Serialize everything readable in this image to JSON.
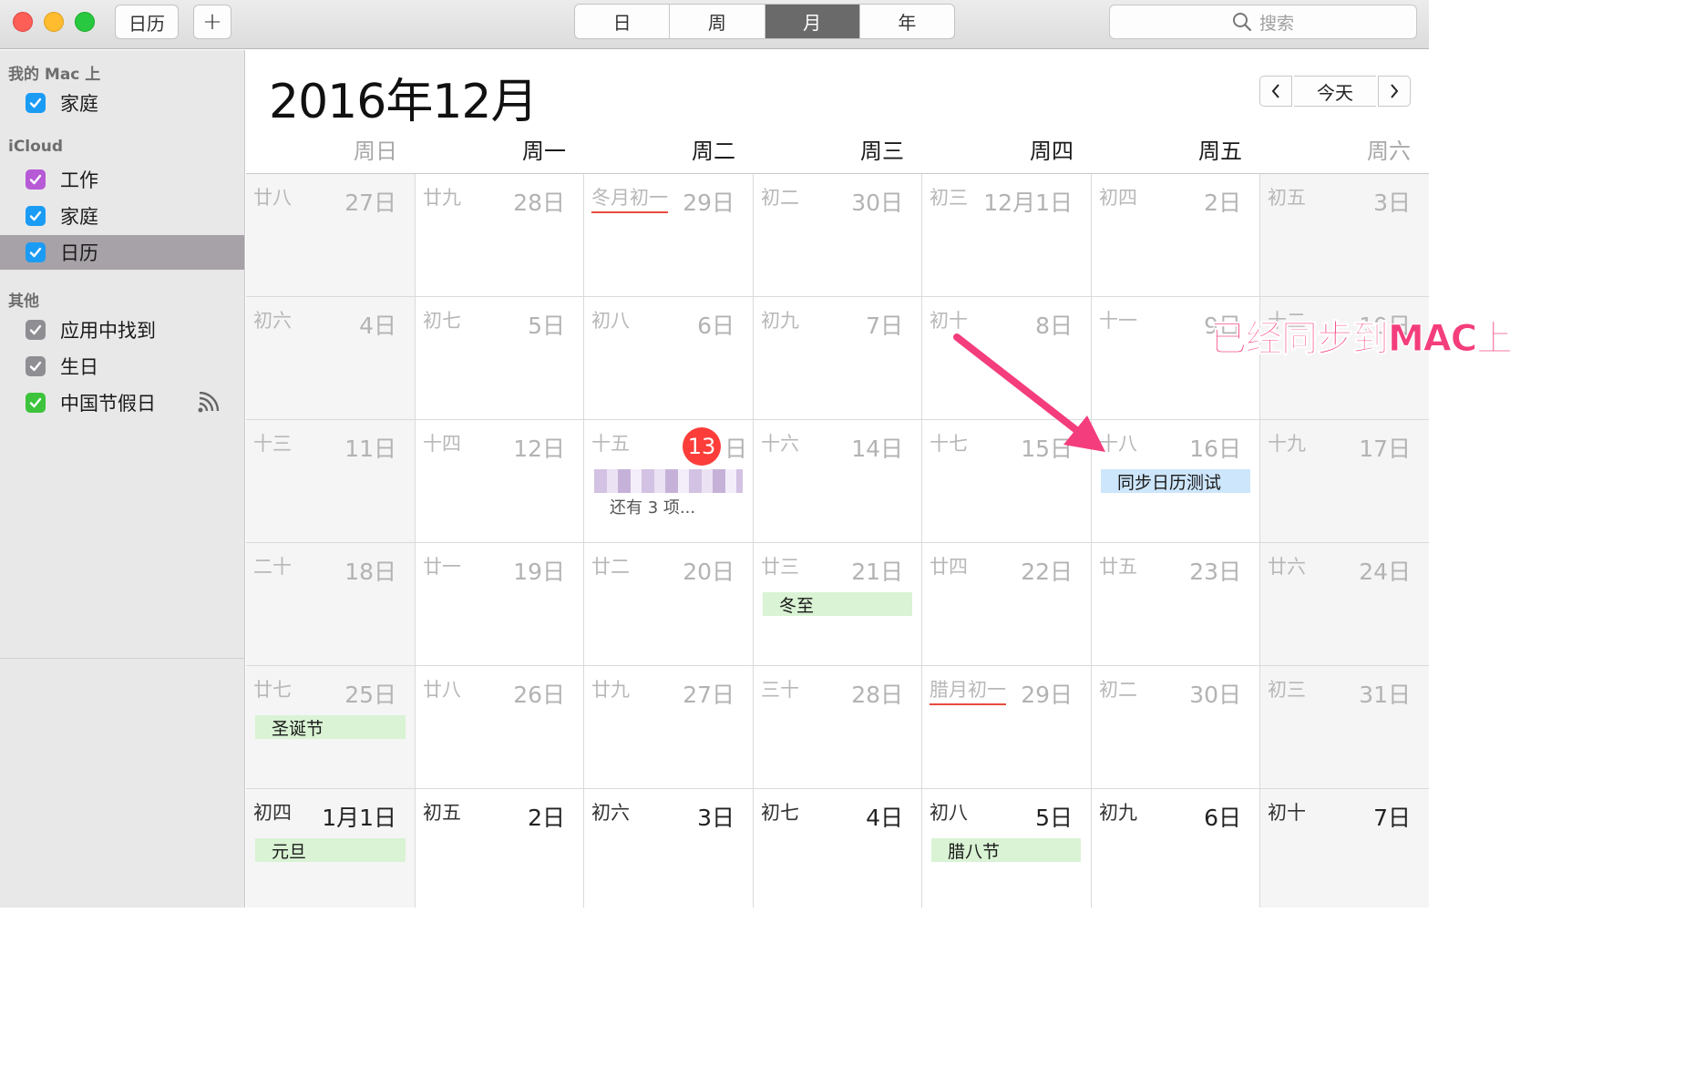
{
  "window": {
    "toolbar": {
      "calendars_button": "日历",
      "add_button": "+",
      "views": [
        {
          "label": "日",
          "active": false
        },
        {
          "label": "周",
          "active": false
        },
        {
          "label": "月",
          "active": true
        },
        {
          "label": "年",
          "active": false
        }
      ],
      "search_placeholder": "搜索"
    },
    "sidebar": {
      "groups": [
        {
          "title": "我的 Mac 上",
          "calendars": [
            {
              "label": "家庭",
              "color": "#1a9cf5",
              "checked": true,
              "selected": false
            }
          ]
        },
        {
          "title": "iCloud",
          "calendars": [
            {
              "label": "工作",
              "color": "#b65ad6",
              "checked": true,
              "selected": false
            },
            {
              "label": "家庭",
              "color": "#1a9cf5",
              "checked": true,
              "selected": false
            },
            {
              "label": "日历",
              "color": "#1a9cf5",
              "checked": true,
              "selected": true
            }
          ]
        },
        {
          "title": "其他",
          "calendars": [
            {
              "label": "应用中找到",
              "color": "#8e8e93",
              "checked": true,
              "selected": false
            },
            {
              "label": "生日",
              "color": "#8e8e93",
              "checked": true,
              "selected": false
            },
            {
              "label": "中国节假日",
              "color": "#3dc43c",
              "checked": true,
              "selected": false,
              "subscribed_icon": "broadcast-icon"
            }
          ]
        }
      ]
    },
    "main": {
      "month_title": "2016年12月",
      "nav": {
        "prev": "‹",
        "today": "今天",
        "next": "›"
      },
      "weekdays": [
        "周日",
        "周一",
        "周二",
        "周三",
        "周四",
        "周五",
        "周六"
      ],
      "weeks": [
        [
          {
            "lunar": "廿八",
            "solar": "27日"
          },
          {
            "lunar": "廿九",
            "solar": "28日"
          },
          {
            "lunar": "冬月初一",
            "solar": "29日",
            "lunar_underline": true
          },
          {
            "lunar": "初二",
            "solar": "30日"
          },
          {
            "lunar": "初三",
            "solar": "12月1日"
          },
          {
            "lunar": "初四",
            "solar": "2日"
          },
          {
            "lunar": "初五",
            "solar": "3日"
          }
        ],
        [
          {
            "lunar": "初六",
            "solar": "4日"
          },
          {
            "lunar": "初七",
            "solar": "5日"
          },
          {
            "lunar": "初八",
            "solar": "6日"
          },
          {
            "lunar": "初九",
            "solar": "7日"
          },
          {
            "lunar": "初十",
            "solar": "8日"
          },
          {
            "lunar": "十一",
            "solar": "9日"
          },
          {
            "lunar": "十二",
            "solar": "10日"
          }
        ],
        [
          {
            "lunar": "十三",
            "solar": "11日"
          },
          {
            "lunar": "十四",
            "solar": "12日"
          },
          {
            "lunar": "十五",
            "solar": "日",
            "today_number": "13",
            "events": [
              {
                "title": "",
                "style": "pixel"
              }
            ],
            "more": "还有 3 项..."
          },
          {
            "lunar": "十六",
            "solar": "14日"
          },
          {
            "lunar": "十七",
            "solar": "15日"
          },
          {
            "lunar": "十八",
            "solar": "16日",
            "events": [
              {
                "title": "同步日历测试",
                "style": "blue"
              }
            ]
          },
          {
            "lunar": "十九",
            "solar": "17日"
          }
        ],
        [
          {
            "lunar": "二十",
            "solar": "18日"
          },
          {
            "lunar": "廿一",
            "solar": "19日"
          },
          {
            "lunar": "廿二",
            "solar": "20日"
          },
          {
            "lunar": "廿三",
            "solar": "21日",
            "events": [
              {
                "title": "冬至",
                "style": "green"
              }
            ]
          },
          {
            "lunar": "廿四",
            "solar": "22日"
          },
          {
            "lunar": "廿五",
            "solar": "23日"
          },
          {
            "lunar": "廿六",
            "solar": "24日"
          }
        ],
        [
          {
            "lunar": "廿七",
            "solar": "25日",
            "events": [
              {
                "title": "圣诞节",
                "style": "green"
              }
            ]
          },
          {
            "lunar": "廿八",
            "solar": "26日"
          },
          {
            "lunar": "廿九",
            "solar": "27日"
          },
          {
            "lunar": "三十",
            "solar": "28日"
          },
          {
            "lunar": "腊月初一",
            "solar": "29日",
            "lunar_underline": true
          },
          {
            "lunar": "初二",
            "solar": "30日"
          },
          {
            "lunar": "初三",
            "solar": "31日"
          }
        ],
        [
          {
            "lunar": "初四",
            "solar": "1月1日",
            "next_month": true,
            "events": [
              {
                "title": "元旦",
                "style": "green"
              }
            ]
          },
          {
            "lunar": "初五",
            "solar": "2日",
            "next_month": true
          },
          {
            "lunar": "初六",
            "solar": "3日",
            "next_month": true
          },
          {
            "lunar": "初七",
            "solar": "4日",
            "next_month": true
          },
          {
            "lunar": "初八",
            "solar": "5日",
            "next_month": true,
            "events": [
              {
                "title": "腊八节",
                "style": "green"
              }
            ]
          },
          {
            "lunar": "初九",
            "solar": "6日",
            "next_month": true
          },
          {
            "lunar": "初十",
            "solar": "7日",
            "next_month": true
          }
        ]
      ]
    },
    "annotation": {
      "text": "已经同步到MAC上",
      "color": "#f43d7c"
    }
  }
}
